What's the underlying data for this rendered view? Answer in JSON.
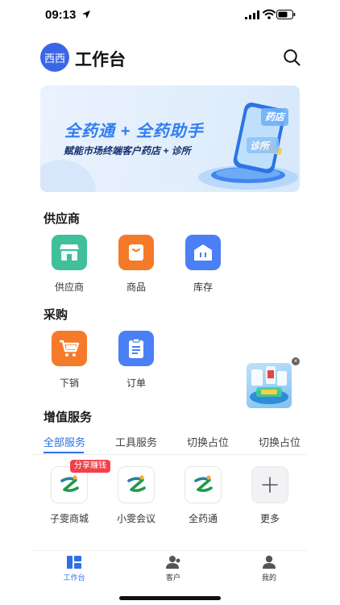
{
  "status_bar": {
    "time": "09:13"
  },
  "header": {
    "avatar_text": "西西",
    "title": "工作台"
  },
  "banner": {
    "title": "全药通 + 全药助手",
    "subtitle": "赋能市场终端客户药店 + 诊所",
    "tag_pharmacy": "药店",
    "tag_clinic": "诊所"
  },
  "sections": {
    "supplier": {
      "title": "供应商",
      "items": [
        {
          "label": "供应商",
          "icon": "store-icon",
          "color": "#3fbf9a"
        },
        {
          "label": "商品",
          "icon": "product-icon",
          "color": "#f57a2a"
        },
        {
          "label": "库存",
          "icon": "warehouse-icon",
          "color": "#4a7ff5"
        }
      ]
    },
    "purchase": {
      "title": "采购",
      "items": [
        {
          "label": "下销",
          "icon": "cart-icon",
          "color": "#f57a2a"
        },
        {
          "label": "订单",
          "icon": "order-icon",
          "color": "#4a7ff5"
        }
      ]
    },
    "services": {
      "title": "增值服务",
      "tabs": [
        "全部服务",
        "工具服务",
        "切换占位",
        "切换占位"
      ],
      "promo_badge": "分享赚钱",
      "items": [
        {
          "label": "子雯商城",
          "icon": "app-logo-icon"
        },
        {
          "label": "小雯会议",
          "icon": "app-logo-icon"
        },
        {
          "label": "全药通",
          "icon": "app-logo-icon"
        },
        {
          "label": "更多",
          "icon": "plus-icon"
        }
      ]
    }
  },
  "bottom_nav": {
    "items": [
      {
        "label": "工作台",
        "icon": "dashboard-icon",
        "active": true
      },
      {
        "label": "客户",
        "icon": "customer-icon",
        "active": false
      },
      {
        "label": "我的",
        "icon": "profile-icon",
        "active": false
      }
    ]
  },
  "colors": {
    "accent": "#2f6fe6",
    "badge": "#f2404b"
  }
}
